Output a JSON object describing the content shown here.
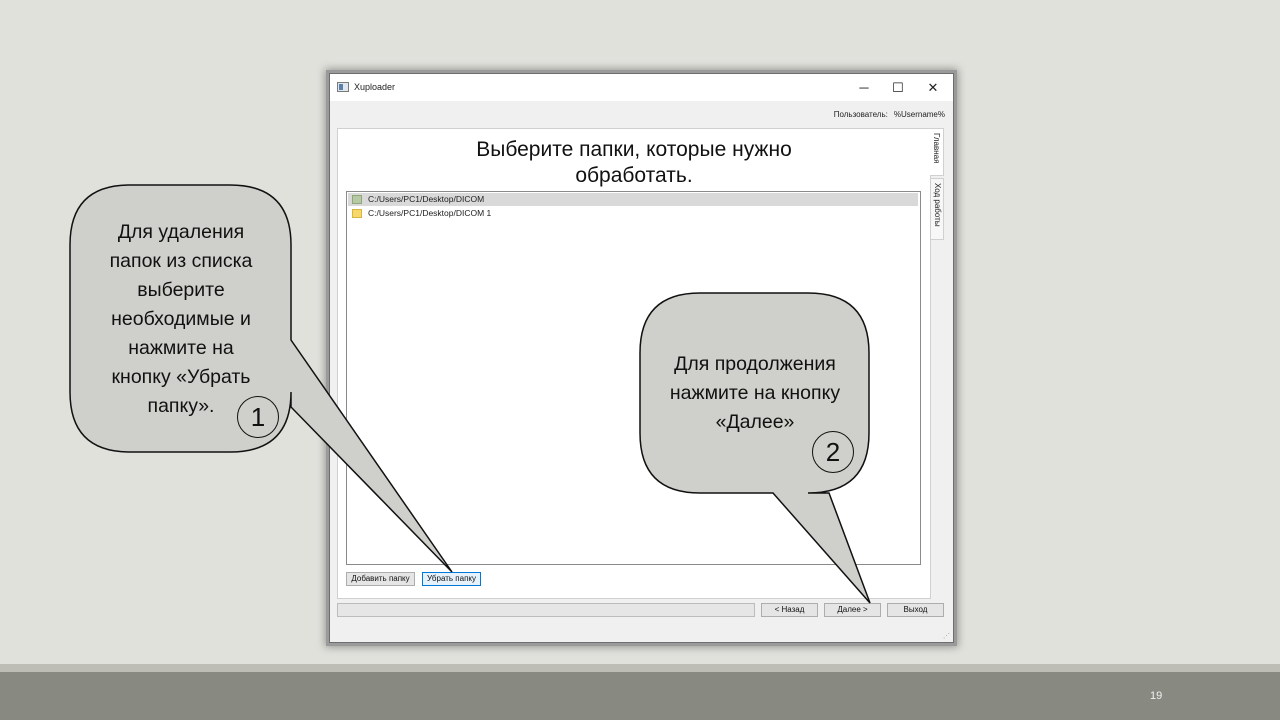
{
  "window": {
    "title": "Xuploader",
    "minimize_glyph": "─",
    "maximize_glyph": "☐",
    "close_glyph": "✕",
    "user_label": "Пользователь:",
    "user_value": "%Username%"
  },
  "main": {
    "heading_line1": "Выберите папки, которые нужно",
    "heading_line2": "обработать.",
    "folders": [
      {
        "path": "C:/Users/PC1/Desktop/DICOM",
        "selected": true,
        "icon": "folder-green-icon"
      },
      {
        "path": "C:/Users/PC1/Desktop/DICOM 1",
        "selected": false,
        "icon": "folder-yellow-icon"
      }
    ],
    "add_button": "Добавить папку",
    "remove_button": "Убрать папку"
  },
  "tabs": [
    {
      "label": "Главная",
      "active": true
    },
    {
      "label": "Ход работы",
      "active": false
    }
  ],
  "footer_buttons": {
    "back": "< Назад",
    "next": "Далее >",
    "exit": "Выход"
  },
  "callouts": {
    "left": {
      "lines": [
        "Для удаления",
        "папок из списка",
        "выберите",
        "необходимые и",
        "нажмите на",
        "кнопку «Убрать",
        "папку»."
      ],
      "number": "1"
    },
    "right": {
      "lines": [
        "Для продолжения",
        "нажмите на кнопку",
        "«Далее»"
      ],
      "number": "2"
    }
  },
  "slide": {
    "page_number": "19"
  },
  "colors": {
    "background": "#e1e1dc",
    "callout_fill": "#cfd0cb",
    "focus": "#0078d7"
  }
}
